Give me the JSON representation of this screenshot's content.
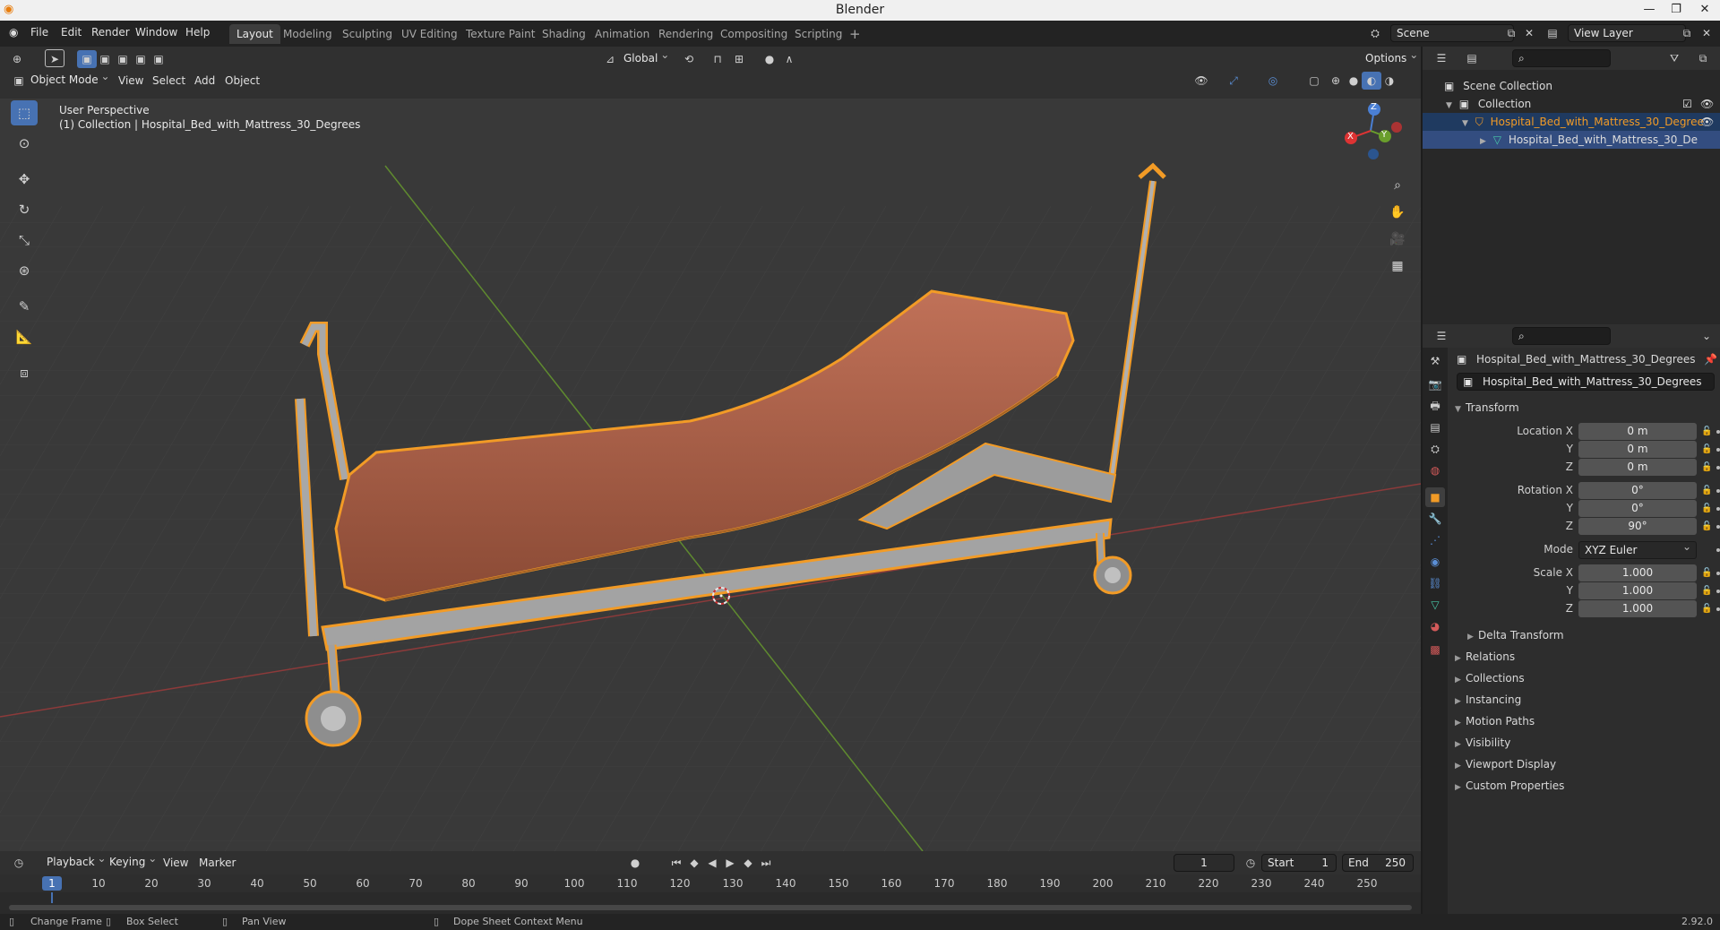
{
  "window": {
    "title": "Blender",
    "minimize": "—",
    "restore": "❐",
    "close": "✕"
  },
  "menu": [
    "File",
    "Edit",
    "Render",
    "Window",
    "Help"
  ],
  "workspaces": [
    "Layout",
    "Modeling",
    "Sculpting",
    "UV Editing",
    "Texture Paint",
    "Shading",
    "Animation",
    "Rendering",
    "Compositing",
    "Scripting"
  ],
  "workspace_add": "+",
  "scene": {
    "name": "Scene",
    "view_layer": "View Layer"
  },
  "viewport_header": {
    "orientation": "Global",
    "options": "Options",
    "mode": "Object Mode",
    "menus": [
      "View",
      "Select",
      "Add",
      "Object"
    ]
  },
  "viewport": {
    "perspective_label": "User Perspective",
    "collection_label": "(1) Collection | Hospital_Bed_with_Mattress_30_Degrees",
    "gizmo": {
      "x": "X",
      "y": "Y",
      "z": "Z"
    }
  },
  "outliner": {
    "rows": [
      {
        "label": "Scene Collection"
      },
      {
        "label": "Collection"
      },
      {
        "label": "Hospital_Bed_with_Mattress_30_Degree"
      },
      {
        "label": "Hospital_Bed_with_Mattress_30_De"
      }
    ]
  },
  "properties": {
    "object_name": "Hospital_Bed_with_Mattress_30_Degrees",
    "datablock_name": "Hospital_Bed_with_Mattress_30_Degrees",
    "transform_title": "Transform",
    "location": {
      "label": "Location X",
      "x": "0 m",
      "y": "0 m",
      "z": "0 m"
    },
    "rotation": {
      "label": "Rotation X",
      "x": "0°",
      "y": "0°",
      "z": "90°"
    },
    "mode": {
      "label": "Mode",
      "value": "XYZ Euler"
    },
    "scale": {
      "label": "Scale X",
      "x": "1.000",
      "y": "1.000",
      "z": "1.000"
    },
    "axis_y": "Y",
    "axis_z": "Z",
    "sub_section": "Delta Transform",
    "sections": [
      "Relations",
      "Collections",
      "Instancing",
      "Motion Paths",
      "Visibility",
      "Viewport Display",
      "Custom Properties"
    ]
  },
  "timeline": {
    "menus": [
      "Playback",
      "Keying",
      "View",
      "Marker"
    ],
    "current_frame": "1",
    "start_label": "Start",
    "start": "1",
    "end_label": "End",
    "end": "250",
    "ruler": [
      "1",
      "10",
      "20",
      "30",
      "40",
      "50",
      "60",
      "70",
      "80",
      "90",
      "100",
      "110",
      "120",
      "130",
      "140",
      "150",
      "160",
      "170",
      "180",
      "190",
      "200",
      "210",
      "220",
      "230",
      "240",
      "250"
    ]
  },
  "statusbar": {
    "items": [
      "Change Frame",
      "Box Select",
      "Pan View",
      "Dope Sheet Context Menu"
    ],
    "version": "2.92.0"
  },
  "colors": {
    "accent": "#4772b3",
    "selection_outline": "#f29b26",
    "mattress": "#b4694e",
    "frame": "#9a9a9a"
  }
}
